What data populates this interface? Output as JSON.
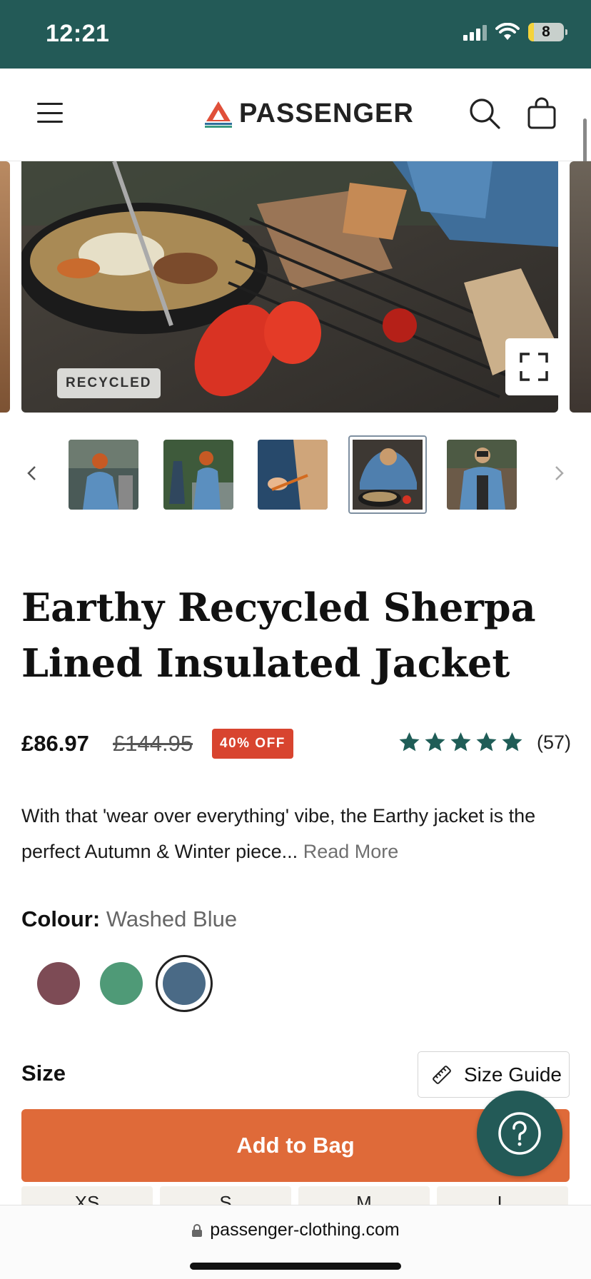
{
  "status_bar": {
    "time": "12:21",
    "battery": "8"
  },
  "header": {
    "brand": "PASSENGER"
  },
  "gallery": {
    "badge": "RECYCLED",
    "thumbnail_count": 5,
    "active_thumbnail": 4
  },
  "product": {
    "title": "Earthy Recycled Sherpa Lined Insulated Jacket",
    "price": "£86.97",
    "was_price": "£144.95",
    "discount": "40% OFF",
    "rating": 5,
    "review_count": "(57)",
    "description": "With that 'wear over everything' vibe, the Earthy jacket is the perfect Autumn & Winter piece...",
    "read_more": "Read More"
  },
  "colour": {
    "label": "Colour:",
    "selected": "Washed Blue",
    "options": [
      {
        "hex": "#7d4b55"
      },
      {
        "hex": "#4f9a77"
      },
      {
        "hex": "#4a6a86"
      }
    ]
  },
  "size": {
    "label": "Size",
    "guide_label": "Size Guide",
    "options": [
      "XS",
      "S",
      "M",
      "L"
    ]
  },
  "cta": {
    "add_to_bag": "Add to Bag"
  },
  "browser": {
    "url": "passenger-clothing.com"
  },
  "colors": {
    "brand_teal": "#235a57",
    "cta_orange": "#df6a39",
    "discount_red": "#d8442f",
    "star_teal": "#1f5d57"
  }
}
